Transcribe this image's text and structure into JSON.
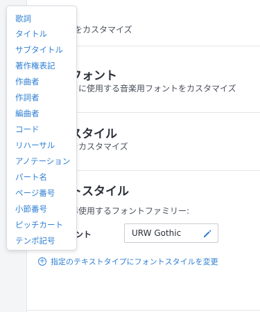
{
  "menu": {
    "items": [
      "歌詞",
      "タイトル",
      "サブタイトル",
      "著作権表記",
      "作曲者",
      "作詞者",
      "編曲者",
      "コード",
      "リハーサル",
      "アノテーション",
      "パート名",
      "ページ番号",
      "小節番号",
      "ピッチカート",
      "テンポ記号"
    ]
  },
  "sections": [
    {
      "title": "",
      "desc": "形をカスタマイズ"
    },
    {
      "title": "フォント",
      "desc": "フに使用する音楽用フォントをカスタマイズ"
    },
    {
      "title": "スタイル",
      "desc": "をカスタマイズ"
    },
    {
      "title": "トスタイル",
      "desc": "準使用するフォントファミリー:"
    }
  ],
  "font_field": {
    "label": "ント",
    "value": "URW Gothic"
  },
  "add_link": {
    "label": "指定のテキストタイプにフォントスタイルを変更"
  },
  "colors": {
    "accent": "#2f7fd3",
    "text": "#2b2f38",
    "border": "#e3e5ea"
  }
}
